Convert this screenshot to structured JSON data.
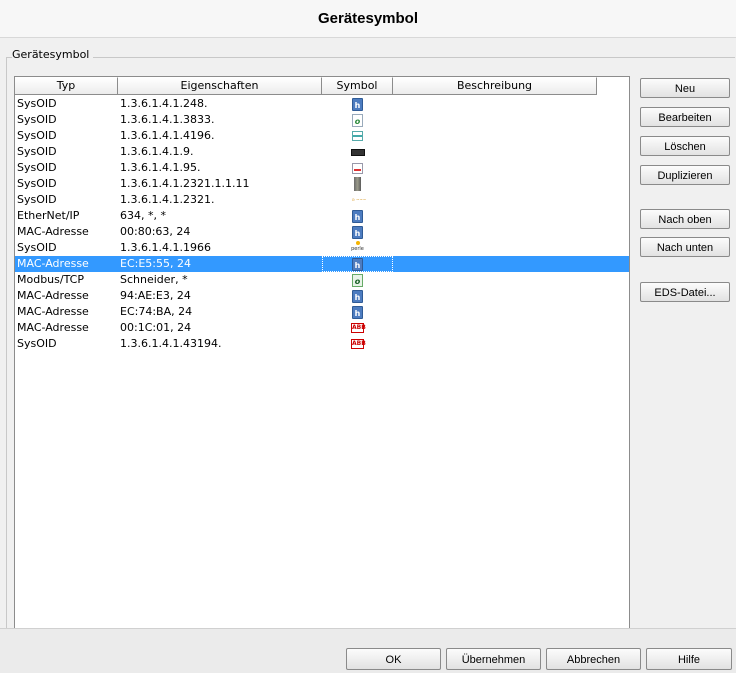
{
  "window": {
    "title": "Gerätesymbol"
  },
  "group": {
    "label": "Gerätesymbol"
  },
  "table": {
    "columns": [
      "Typ",
      "Eigenschaften",
      "Symbol",
      "Beschreibung"
    ],
    "rows": [
      {
        "typ": "SysOID",
        "eigenschaften": "1.3.6.1.4.1.248.",
        "symbol": "hirschmann-icon",
        "beschreibung": ""
      },
      {
        "typ": "SysOID",
        "eigenschaften": "1.3.6.1.4.1.3833.",
        "symbol": "swirl-icon",
        "beschreibung": ""
      },
      {
        "typ": "SysOID",
        "eigenschaften": "1.3.6.1.4.1.4196.",
        "symbol": "teal-box-icon",
        "beschreibung": ""
      },
      {
        "typ": "SysOID",
        "eigenschaften": "1.3.6.1.4.1.9.",
        "symbol": "rack-switch-icon",
        "beschreibung": ""
      },
      {
        "typ": "SysOID",
        "eigenschaften": "1.3.6.1.4.1.95.",
        "symbol": "red-strip-icon",
        "beschreibung": ""
      },
      {
        "typ": "SysOID",
        "eigenschaften": "1.3.6.1.4.1.2321.1.1.11",
        "symbol": "cabinet-icon",
        "beschreibung": ""
      },
      {
        "typ": "SysOID",
        "eigenschaften": "1.3.6.1.4.1.2321.",
        "symbol": "tiny-logo-icon",
        "beschreibung": ""
      },
      {
        "typ": "EtherNet/IP",
        "eigenschaften": "634, *, *",
        "symbol": "hirschmann-icon",
        "beschreibung": ""
      },
      {
        "typ": "MAC-Adresse",
        "eigenschaften": "00:80:63, 24",
        "symbol": "hirschmann-icon",
        "beschreibung": ""
      },
      {
        "typ": "SysOID",
        "eigenschaften": "1.3.6.1.4.1.1966",
        "symbol": "perle-icon",
        "beschreibung": ""
      },
      {
        "typ": "MAC-Adresse",
        "eigenschaften": "EC:E5:55, 24",
        "symbol": "hirschmann-icon",
        "beschreibung": "",
        "selected": true
      },
      {
        "typ": "Modbus/TCP",
        "eigenschaften": "Schneider, *",
        "symbol": "swirl-dark-icon",
        "beschreibung": ""
      },
      {
        "typ": "MAC-Adresse",
        "eigenschaften": "94:AE:E3, 24",
        "symbol": "hirschmann-icon",
        "beschreibung": ""
      },
      {
        "typ": "MAC-Adresse",
        "eigenschaften": "EC:74:BA, 24",
        "symbol": "hirschmann-icon",
        "beschreibung": ""
      },
      {
        "typ": "MAC-Adresse",
        "eigenschaften": "00:1C:01, 24",
        "symbol": "abb-icon",
        "beschreibung": ""
      },
      {
        "typ": "SysOID",
        "eigenschaften": "1.3.6.1.4.1.43194.",
        "symbol": "abb-icon",
        "beschreibung": ""
      }
    ]
  },
  "icon_text": {
    "hirschmann": "h",
    "swirl": "o",
    "perle": "perle",
    "abb": "ABB",
    "tiny": "⊙ ~~~"
  },
  "side_buttons": {
    "neu": "Neu",
    "bearbeiten": "Bearbeiten",
    "loeschen": "Löschen",
    "duplizieren": "Duplizieren",
    "nach_oben": "Nach oben",
    "nach_unten": "Nach unten",
    "eds_datei": "EDS-Datei..."
  },
  "footer_buttons": {
    "ok": "OK",
    "uebernehmen": "Übernehmen",
    "abbrechen": "Abbrechen",
    "hilfe": "Hilfe"
  },
  "colors": {
    "selection": "#3399ff",
    "hirschmann_blue": "#4d7cc0",
    "abb_red": "#cc0000"
  }
}
